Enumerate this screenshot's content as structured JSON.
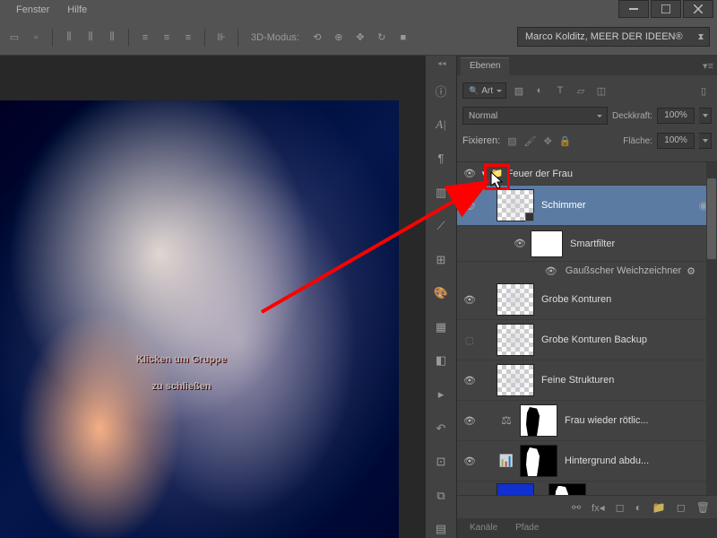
{
  "menu": {
    "fenster": "Fenster",
    "hilfe": "Hilfe"
  },
  "toolbar": {
    "mode_label": "3D-Modus:",
    "workspace": "Marco Kolditz, MEER DER IDEEN®"
  },
  "panels": {
    "ebenen_tab": "Ebenen",
    "kanale_tab": "Kanäle",
    "pfade_tab": "Pfade"
  },
  "layer_opts": {
    "kind": "Art",
    "blend": "Normal",
    "opacity_label": "Deckkraft:",
    "opacity_val": "100%",
    "fill_label": "Fläche:",
    "fill_val": "100%",
    "lock_label": "Fixieren:"
  },
  "layers": {
    "group": "Feuer der Frau",
    "schimmer": "Schimmer",
    "smartfilter": "Smartfilter",
    "gauss": "Gaußscher Weichzeichner",
    "grobe": "Grobe Konturen",
    "grobe_backup": "Grobe Konturen Backup",
    "feine": "Feine Strukturen",
    "frau": "Frau wieder rötlic...",
    "hintergrund": "Hintergrund abdu..."
  },
  "footer": {
    "fx": "fx"
  },
  "annotation": {
    "line1": "Klicken um Gruppe",
    "line2": "zu schließen"
  }
}
